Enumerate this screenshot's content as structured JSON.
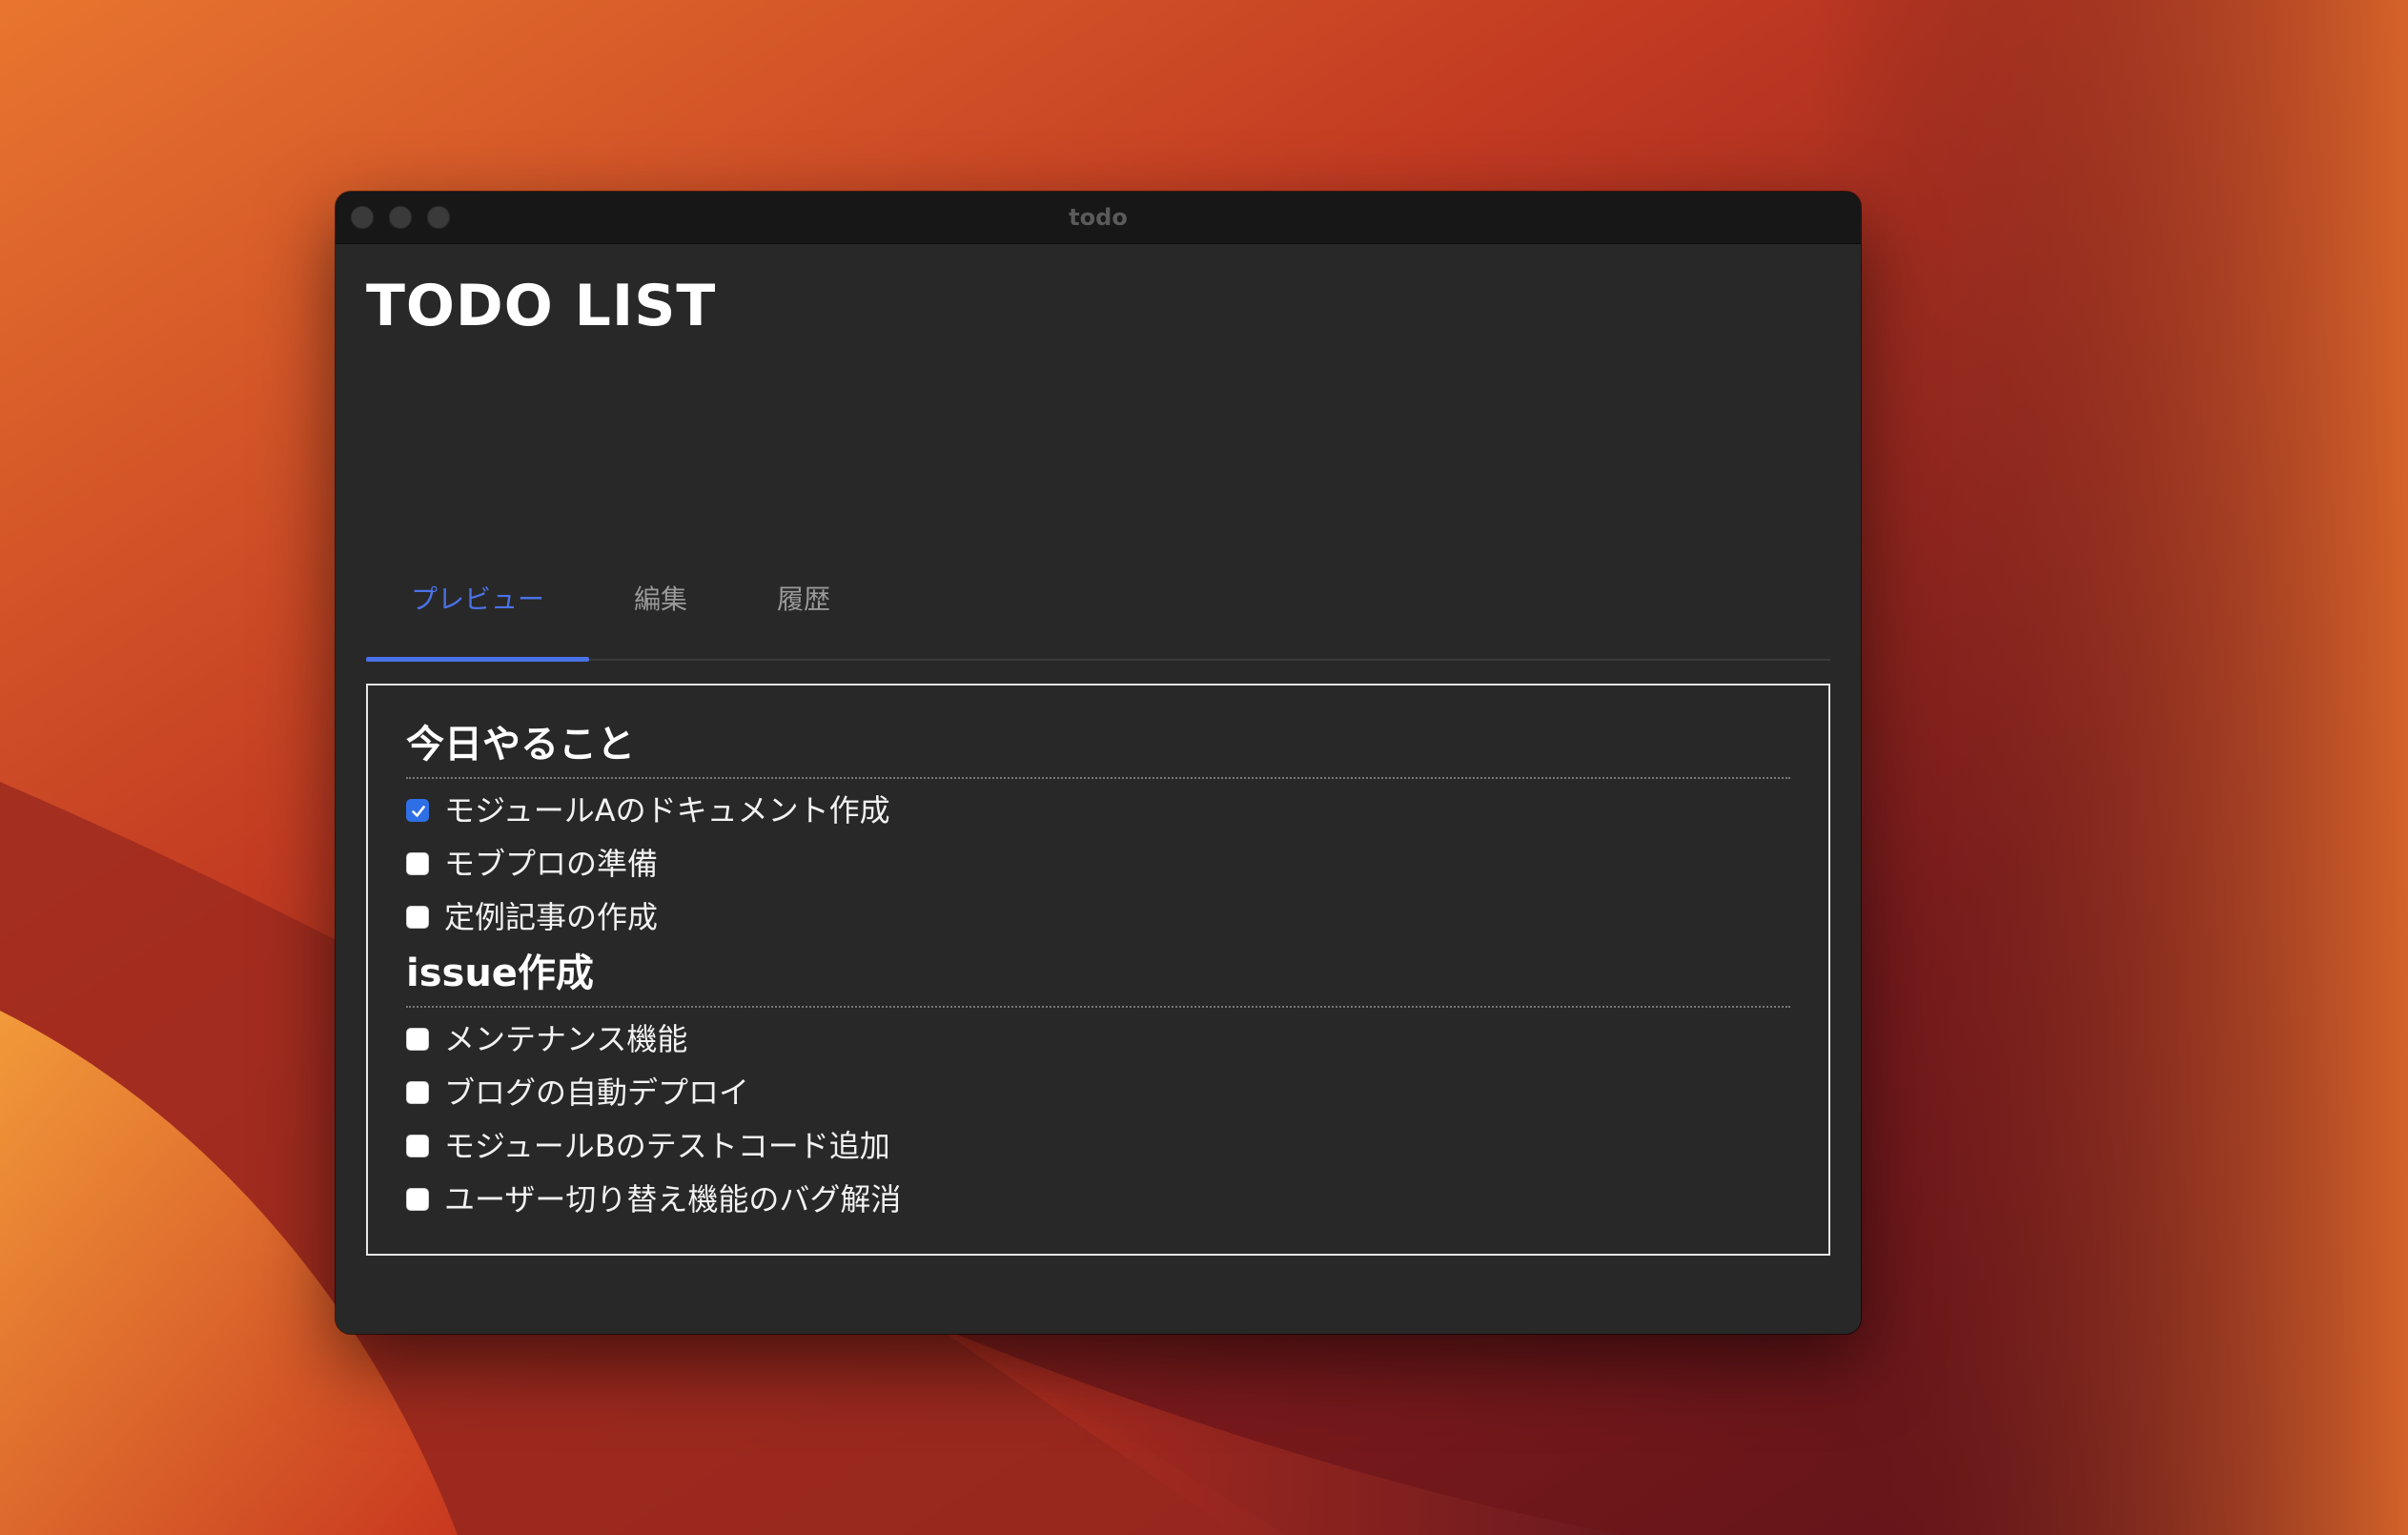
{
  "window": {
    "title": "todo"
  },
  "app": {
    "title": "TODO LIST"
  },
  "tabs": [
    {
      "label": "プレビュー",
      "active": true
    },
    {
      "label": "編集",
      "active": false
    },
    {
      "label": "履歴",
      "active": false
    }
  ],
  "sections": [
    {
      "heading": "今日やること",
      "items": [
        {
          "label": "モジュールAのドキュメント作成",
          "checked": true
        },
        {
          "label": "モブプロの準備",
          "checked": false
        },
        {
          "label": "定例記事の作成",
          "checked": false
        }
      ]
    },
    {
      "heading": "issue作成",
      "items": [
        {
          "label": "メンテナンス機能",
          "checked": false
        },
        {
          "label": "ブログの自動デプロイ",
          "checked": false
        },
        {
          "label": "モジュールBのテストコード追加",
          "checked": false
        },
        {
          "label": "ユーザー切り替え機能のバグ解消",
          "checked": false
        }
      ]
    }
  ],
  "colors": {
    "accent": "#4a72e8",
    "window_bg": "#282828",
    "titlebar_bg": "#171717",
    "checkbox_checked": "#2f6fe6"
  }
}
